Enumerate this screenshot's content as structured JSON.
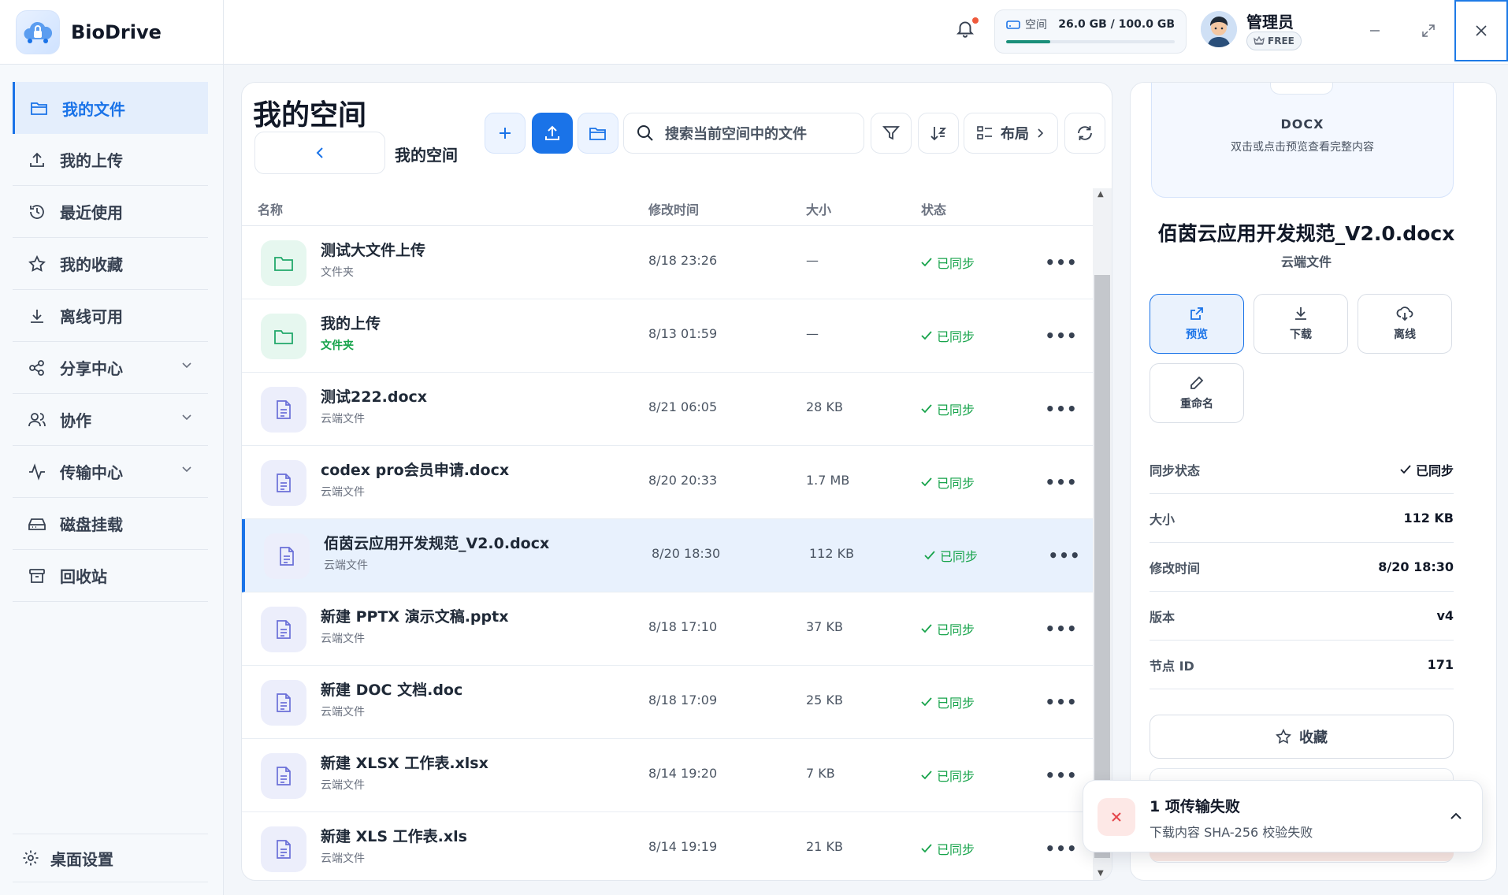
{
  "app": {
    "name": "BioDrive"
  },
  "header": {
    "storage_label": "空间",
    "storage_value": "26.0 GB / 100.0 GB",
    "storage_fraction": 0.26,
    "user_name": "管理员",
    "plan_badge": "FREE"
  },
  "sidebar": {
    "items": [
      {
        "label": "我的文件",
        "icon": "folder-open-icon",
        "active": true
      },
      {
        "label": "我的上传",
        "icon": "upload-icon"
      },
      {
        "label": "最近使用",
        "icon": "history-icon"
      },
      {
        "label": "我的收藏",
        "icon": "star-icon"
      },
      {
        "label": "离线可用",
        "icon": "download-icon"
      },
      {
        "label": "分享中心",
        "icon": "share-icon",
        "expandable": true
      },
      {
        "label": "协作",
        "icon": "users-icon",
        "expandable": true
      },
      {
        "label": "传输中心",
        "icon": "activity-icon",
        "expandable": true
      },
      {
        "label": "磁盘挂载",
        "icon": "hard-drive-icon"
      },
      {
        "label": "回收站",
        "icon": "archive-icon"
      }
    ],
    "settings_label": "桌面设置"
  },
  "main": {
    "title": "我的空间",
    "breadcrumb": "我的空间",
    "search_placeholder": "搜索当前空间中的文件",
    "layout_label": "布局",
    "columns": {
      "name": "名称",
      "modified": "修改时间",
      "size": "大小",
      "status": "状态"
    },
    "files": [
      {
        "name": "测试大文件上传",
        "type": "文件夹",
        "kind": "folder",
        "modified": "8/18 23:26",
        "size": "—",
        "status": "已同步"
      },
      {
        "name": "我的上传",
        "type": "文件夹",
        "kind": "folder",
        "highlight": true,
        "modified": "8/13 01:59",
        "size": "—",
        "status": "已同步"
      },
      {
        "name": "测试222.docx",
        "type": "云端文件",
        "kind": "doc",
        "modified": "8/21 06:05",
        "size": "28 KB",
        "status": "已同步"
      },
      {
        "name": "codex pro会员申请.docx",
        "type": "云端文件",
        "kind": "doc",
        "modified": "8/20 20:33",
        "size": "1.7 MB",
        "status": "已同步"
      },
      {
        "name": "佰茵云应用开发规范_V2.0.docx",
        "type": "云端文件",
        "kind": "doc",
        "modified": "8/20 18:30",
        "size": "112 KB",
        "status": "已同步",
        "selected": true
      },
      {
        "name": "新建 PPTX 演示文稿.pptx",
        "type": "云端文件",
        "kind": "doc",
        "modified": "8/18 17:10",
        "size": "37 KB",
        "status": "已同步"
      },
      {
        "name": "新建 DOC 文档.doc",
        "type": "云端文件",
        "kind": "doc",
        "modified": "8/18 17:09",
        "size": "25 KB",
        "status": "已同步"
      },
      {
        "name": "新建 XLSX 工作表.xlsx",
        "type": "云端文件",
        "kind": "doc",
        "modified": "8/14 19:20",
        "size": "7 KB",
        "status": "已同步"
      },
      {
        "name": "新建 XLS 工作表.xls",
        "type": "云端文件",
        "kind": "doc",
        "modified": "8/14 19:19",
        "size": "21 KB",
        "status": "已同步"
      }
    ]
  },
  "detail": {
    "ext": "DOCX",
    "preview_hint": "双击或点击预览查看完整内容",
    "title": "佰茵云应用开发规范_V2.0.docx",
    "subtitle": "云端文件",
    "actions": [
      "预览",
      "下载",
      "离线",
      "重命名"
    ],
    "info": [
      {
        "key": "同步状态",
        "value": "已同步"
      },
      {
        "key": "大小",
        "value": "112 KB"
      },
      {
        "key": "修改时间",
        "value": "8/20 18:30"
      },
      {
        "key": "版本",
        "value": "v4"
      },
      {
        "key": "节点 ID",
        "value": "171"
      }
    ],
    "favorite_label": "收藏"
  },
  "toast": {
    "title": "1 项传输失败",
    "message": "下载内容 SHA-256 校验失败"
  },
  "colors": {
    "accent": "#1a73e8",
    "success": "#16a34a",
    "danger": "#e5484d"
  }
}
